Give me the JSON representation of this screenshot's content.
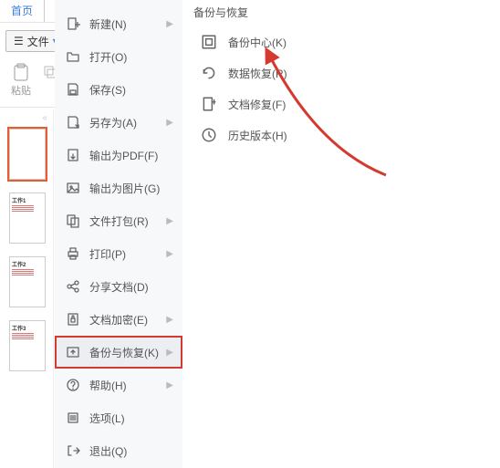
{
  "tab_home": "首页",
  "file_btn": "文件",
  "toolbar": {
    "paste_label": "粘贴"
  },
  "menu1": [
    {
      "icon": "new",
      "label": "新建(N)",
      "arrow": true
    },
    {
      "icon": "open",
      "label": "打开(O)",
      "arrow": false
    },
    {
      "icon": "save",
      "label": "保存(S)",
      "arrow": false
    },
    {
      "icon": "saveas",
      "label": "另存为(A)",
      "arrow": true
    },
    {
      "icon": "pdf",
      "label": "输出为PDF(F)",
      "arrow": false
    },
    {
      "icon": "img",
      "label": "输出为图片(G)",
      "arrow": false
    },
    {
      "icon": "pack",
      "label": "文件打包(R)",
      "arrow": true
    },
    {
      "icon": "print",
      "label": "打印(P)",
      "arrow": true
    },
    {
      "icon": "share",
      "label": "分享文档(D)",
      "arrow": false
    },
    {
      "icon": "lock",
      "label": "文档加密(E)",
      "arrow": true
    },
    {
      "icon": "backup",
      "label": "备份与恢复(K)",
      "arrow": true,
      "selected": true,
      "highlight": true
    },
    {
      "icon": "help",
      "label": "帮助(H)",
      "arrow": true
    },
    {
      "icon": "opts",
      "label": "选项(L)",
      "arrow": false
    },
    {
      "icon": "exit",
      "label": "退出(Q)",
      "arrow": false
    }
  ],
  "submenu_header": "备份与恢复",
  "submenu": [
    {
      "icon": "center",
      "label": "备份中心(K)"
    },
    {
      "icon": "restore",
      "label": "数据恢复(R)"
    },
    {
      "icon": "repair",
      "label": "文档修复(F)"
    },
    {
      "icon": "history",
      "label": "历史版本(H)"
    }
  ],
  "slides": [
    {
      "num": "1",
      "title": "",
      "selected": true
    },
    {
      "num": "2",
      "title": "工作1"
    },
    {
      "num": "3",
      "title": "工作2"
    },
    {
      "num": "4",
      "title": "工作3"
    }
  ]
}
